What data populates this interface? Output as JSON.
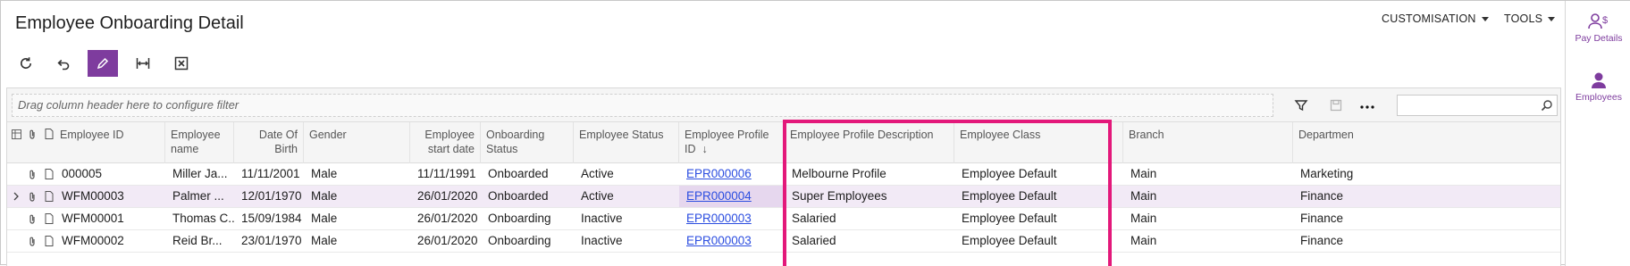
{
  "page": {
    "title": "Employee Onboarding Detail"
  },
  "header_menus": [
    {
      "label": "CUSTOMISATION"
    },
    {
      "label": "TOOLS"
    }
  ],
  "toolbar": [
    {
      "name": "refresh-icon"
    },
    {
      "name": "undo-icon"
    },
    {
      "name": "edit-icon",
      "active": true
    },
    {
      "name": "fit-columns-icon"
    },
    {
      "name": "export-excel-icon"
    }
  ],
  "right_panel": [
    {
      "label": "Pay Details",
      "icon": "pay-details-icon"
    },
    {
      "label": "Employees",
      "icon": "employees-icon"
    }
  ],
  "grid": {
    "filter_placeholder": "Drag column header here to configure filter",
    "search_value": "",
    "columns": [
      {
        "label": "Employee ID"
      },
      {
        "label": "Employee name"
      },
      {
        "label": "Date Of Birth"
      },
      {
        "label": "Gender"
      },
      {
        "label": "Employee start date"
      },
      {
        "label": "Onboarding Status"
      },
      {
        "label": "Employee Status"
      },
      {
        "label": "Employee Profile ID",
        "sort": "↓"
      },
      {
        "label": "Employee Profile Description"
      },
      {
        "label": "Employee Class"
      },
      {
        "label": "Branch"
      },
      {
        "label": "Departmen"
      }
    ],
    "rows": [
      {
        "id": "000005",
        "name": "Miller Ja...",
        "dob": "11/11/2001",
        "gender": "Male",
        "start": "11/11/1991",
        "onboarding": "Onboarded",
        "status": "Active",
        "profile_id": "EPR000006",
        "profile_desc": "Melbourne Profile",
        "class": "Employee Default",
        "branch": "Main",
        "dept": "Marketing"
      },
      {
        "id": "WFM00003",
        "name": "Palmer ...",
        "dob": "12/01/1970",
        "gender": "Male",
        "start": "26/01/2020",
        "onboarding": "Onboarded",
        "status": "Active",
        "profile_id": "EPR000004",
        "profile_desc": "Super Employees",
        "class": "Employee Default",
        "branch": "Main",
        "dept": "Finance",
        "selected": true
      },
      {
        "id": "WFM00001",
        "name": "Thomas C...",
        "dob": "15/09/1984",
        "gender": "Male",
        "start": "26/01/2020",
        "onboarding": "Onboarding",
        "status": "Inactive",
        "profile_id": "EPR000003",
        "profile_desc": "Salaried",
        "class": "Employee Default",
        "branch": "Main",
        "dept": "Finance"
      },
      {
        "id": "WFM00002",
        "name": "Reid Br...",
        "dob": "23/01/1970",
        "gender": "Male",
        "start": "26/01/2020",
        "onboarding": "Onboarding",
        "status": "Inactive",
        "profile_id": "EPR000003",
        "profile_desc": "Salaried",
        "class": "Employee Default",
        "branch": "Main",
        "dept": "Finance"
      }
    ]
  },
  "colors": {
    "accent": "#7e3c9e",
    "highlight": "#e3187a",
    "link": "#2c4ee0"
  }
}
